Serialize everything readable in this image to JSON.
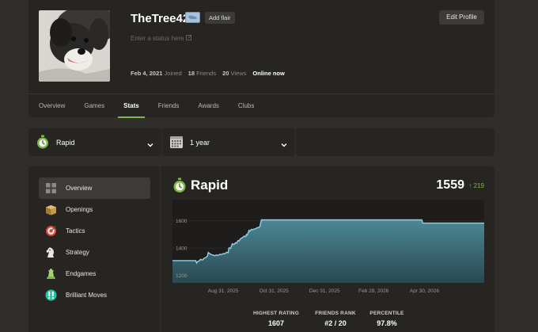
{
  "profile": {
    "username": "TheTree42",
    "add_flair_label": "Add flair",
    "status_placeholder": "Enter a status here",
    "joined_date": "Feb 4, 2021",
    "joined_label": "Joined",
    "friends_count": "18",
    "friends_label": "Friends",
    "views_count": "20",
    "views_label": "Views",
    "online_label": "Online now",
    "edit_profile_label": "Edit Profile"
  },
  "tabs": [
    {
      "label": "Overview"
    },
    {
      "label": "Games"
    },
    {
      "label": "Stats",
      "active": true
    },
    {
      "label": "Friends"
    },
    {
      "label": "Awards"
    },
    {
      "label": "Clubs"
    }
  ],
  "filters": {
    "variant": {
      "label": "Rapid",
      "icon": "stopwatch-icon"
    },
    "period": {
      "label": "1 year",
      "icon": "calendar-icon"
    }
  },
  "sidebar": {
    "items": [
      {
        "label": "Overview",
        "icon": "grid-icon",
        "active": true
      },
      {
        "label": "Openings",
        "icon": "book-icon"
      },
      {
        "label": "Tactics",
        "icon": "target-icon"
      },
      {
        "label": "Strategy",
        "icon": "knight-icon"
      },
      {
        "label": "Endgames",
        "icon": "endgame-icon"
      },
      {
        "label": "Brilliant Moves",
        "icon": "brilliant-icon"
      }
    ]
  },
  "main": {
    "title": "Rapid",
    "rating": "1559",
    "rating_delta": "219",
    "summary": [
      {
        "label": "HIGHEST RATING",
        "value": "1607"
      },
      {
        "label": "FRIENDS RANK",
        "value": "#2 / 20"
      },
      {
        "label": "PERCENTILE",
        "value": "97.8%"
      }
    ]
  },
  "colors": {
    "accent": "#81b64c",
    "line": "#8fd3ea",
    "fill_top": "#4f8d9d",
    "fill_bottom": "#2b4a53"
  },
  "chart_data": {
    "type": "area",
    "yticks": [
      "1600",
      "1400",
      "1200"
    ],
    "ytick_values": [
      1600,
      1400,
      1200
    ],
    "xticks": [
      "Aug 31, 2025",
      "Oct 31, 2025",
      "Dec 31, 2025",
      "Feb 28, 2026",
      "Apr 30, 2026"
    ],
    "ylim": [
      1145,
      1755
    ],
    "xlim": [
      0,
      375
    ],
    "xtick_positions": [
      61,
      122,
      183,
      242,
      303
    ],
    "x": [
      0,
      28,
      29,
      30,
      32,
      34,
      36,
      38,
      40,
      42,
      43,
      45,
      47,
      49,
      51,
      53,
      55,
      57,
      59,
      61,
      63,
      65,
      67,
      68,
      70,
      72,
      74,
      76,
      77,
      79,
      80,
      82,
      84,
      86,
      88,
      89,
      90,
      92,
      93,
      95,
      96,
      98,
      100,
      102,
      104,
      105,
      107,
      110,
      300,
      301,
      375
    ],
    "values": [
      1308,
      1308,
      1290,
      1300,
      1306,
      1318,
      1312,
      1325,
      1330,
      1340,
      1368,
      1358,
      1352,
      1348,
      1345,
      1350,
      1346,
      1355,
      1352,
      1360,
      1358,
      1370,
      1366,
      1402,
      1398,
      1432,
      1426,
      1440,
      1436,
      1456,
      1452,
      1470,
      1476,
      1488,
      1484,
      1500,
      1496,
      1530,
      1524,
      1538,
      1534,
      1540,
      1542,
      1550,
      1552,
      1556,
      1607,
      1607,
      1607,
      1583,
      1583
    ]
  }
}
